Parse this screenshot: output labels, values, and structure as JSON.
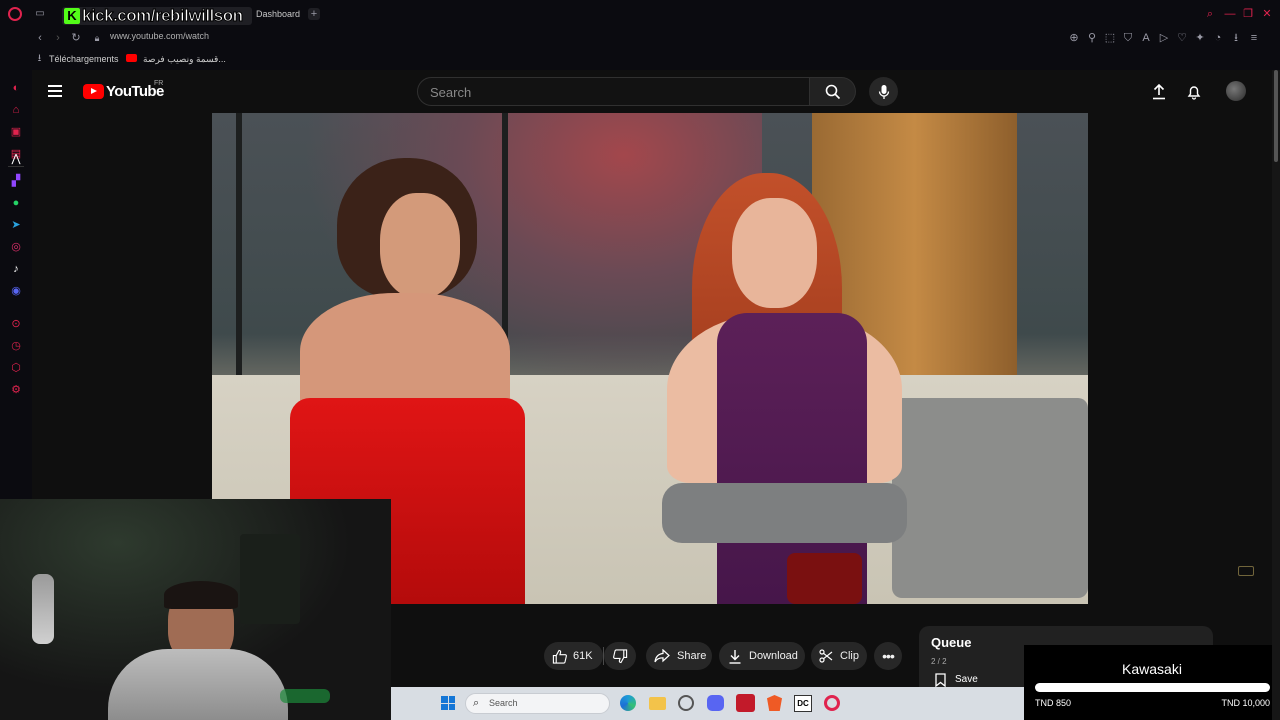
{
  "browser": {
    "tab_title": "Dashboard",
    "overlay_text": "kick.com/rebilwillson",
    "url": "www.youtube.com/watch",
    "bookmarks": [
      {
        "label": "Téléchargements"
      },
      {
        "label": "قسمة ونصيب فرصة..."
      }
    ]
  },
  "youtube": {
    "logo": "YouTube",
    "country_code": "FR",
    "search_placeholder": "Search"
  },
  "actions": {
    "likes": "61K",
    "share": "Share",
    "download": "Download",
    "clip": "Clip"
  },
  "queue": {
    "title": "Queue",
    "position": "2 / 2",
    "save": "Save"
  },
  "taskbar": {
    "search_placeholder": "Search"
  },
  "overlay_widget": {
    "title": "Kawasaki",
    "progress": 0.0,
    "min_label": "TND 850",
    "max_label": "TND 10,000"
  },
  "colors": {
    "youtube_red": "#ff0000",
    "opera_red": "#e0234e",
    "kick_green": "#53fc18"
  }
}
